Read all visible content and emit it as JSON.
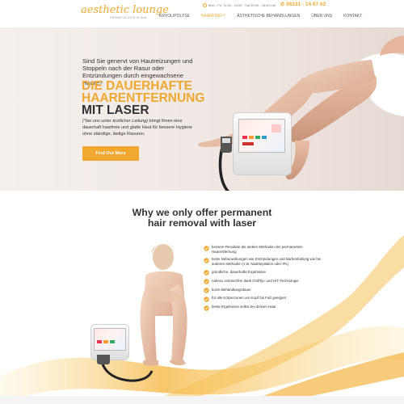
{
  "header": {
    "logo_script": "aesthetic lounge",
    "logo_sub": "DERMATOLOGIE KLINIK",
    "hours": "Mon - Fri: 11:00 - 19:00 · Sat 09:00 - 18:00 Uhr",
    "phone": "06131 - 14 67 62",
    "nav": [
      {
        "label": "KRYOLIPOLYSE",
        "active": false
      },
      {
        "label": "HAARFREI™",
        "active": true
      },
      {
        "label": "ÄSTHETISCHE BEHANDLUNGEN",
        "active": false
      },
      {
        "label": "ÜBER UNS",
        "active": false
      },
      {
        "label": "KONTAKT",
        "active": false
      }
    ]
  },
  "hero": {
    "intro": "Sind Sie genervt von Hautreizungen und Stoppeln nach der Rasur oder Entzündungen durch eingewachsene Haare?",
    "title_line1": "DIE DAUERHAFTE",
    "title_line2": "HAARENTFERNUNG",
    "title_line3": "MIT LASER",
    "body_em": "(*bei uns unter ärztlicher Leitung)",
    "body_rest": " bringt Ihnen eine dauerhaft haarfreie und glatte Haut für bessere Hygiene ohne ständige, lästige Rasuren.",
    "cta": "Find Out More"
  },
  "section2": {
    "title_line1": "Why we only offer permanent",
    "title_line2": "hair removal with laser",
    "features": [
      "bessere Resultate als andere Methoden der permanenten Haarentfernung",
      "keine Nebenwirkungen wie Entzündungen und Narbenbildung wie bei anderen Methoden (z.B. Nadelepilation oder IPL)",
      "gründliche, dauerhafte Ergebnisse",
      "nahezu schmerzfrei dank ChillTip- und HIT-Technologie",
      "kurze Behandlungsdauer",
      "für alle Körperzonen von Kopf bis Fuß geeignet",
      "beste Ergebnisse selbst bei dickem Haar"
    ]
  },
  "colors": {
    "accent": "#f0a830",
    "text": "#333333",
    "hero_bg": "#efe6e2"
  }
}
